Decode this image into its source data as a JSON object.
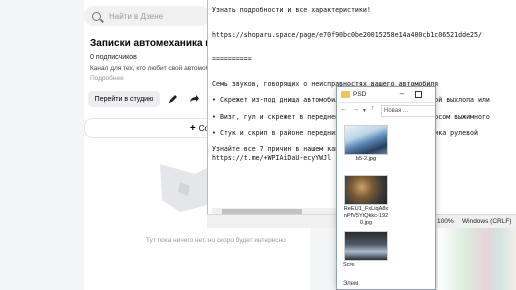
{
  "zen": {
    "search_placeholder": "Найти в Дзене",
    "channel_title": "Записки автомеханика из п",
    "subscribers": "0 подписчиков",
    "description": "Канал для тех, кто любит свой автомобиль",
    "more_link": "Подробнее",
    "studio_button": "Перейти в студию",
    "create_button": "Созд",
    "empty_text": "Тут пока ничего нет, но скоро будет интересно"
  },
  "notepad": {
    "lines": [
      "Узнать подробности и все характеристики!",
      "",
      "",
      "https://shoparu.space/page/e70f90bc0be20015258e14a400cb1c06521dde25/",
      "",
      "",
      "==========",
      "",
      "",
      "Семь звуков, говорящих о неисправностях вашего автомобиля",
      "",
      "• Скрежет из-под днища автомобиля               с системой выхлопа или",
      "",
      "• Визг, гул и скрежет в передней ч              ны с износом выжимного",
      "",
      "• Стук и скрип в районе передних к              наконечника рулевой",
      "",
      "Узнайте все 7 причин в нашем канал",
      "https://t.me/+WPIAiDaU-ecyYWJl"
    ],
    "zoom": "100%",
    "encoding": "Windows (CRLF)"
  },
  "explorer": {
    "title": "PSD",
    "address": "Новая ...",
    "files": [
      {
        "name": "b5-2.jpg"
      },
      {
        "name": "ReEU1_FxLiqA8xnPfV5YtQkkc-1920.jpg"
      },
      {
        "name": "Scre"
      }
    ],
    "status": "Элем"
  }
}
